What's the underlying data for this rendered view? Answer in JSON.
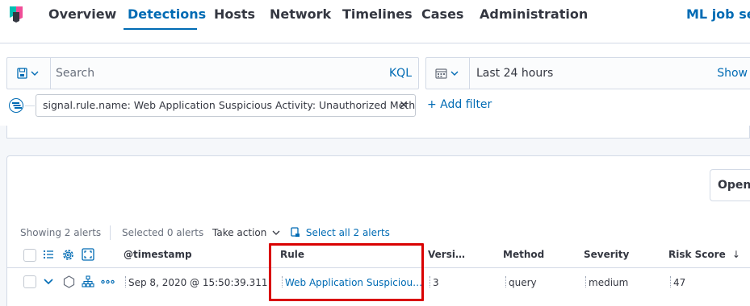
{
  "nav": {
    "tabs": [
      "Overview",
      "Detections",
      "Hosts",
      "Network",
      "Timelines",
      "Cases",
      "Administration"
    ],
    "active_tab": "Detections",
    "ml_link": "ML job set"
  },
  "query_bar": {
    "search_placeholder": "Search",
    "language": "KQL",
    "time_range": "Last 24 hours",
    "show_label": "Show"
  },
  "filters": {
    "pill_text": "signal.rule.name: Web Application Suspicious Activity: Unauthorized Method",
    "remove_glyph": "✕",
    "add_filter": "+ Add filter"
  },
  "panel": {
    "open_button": "Open"
  },
  "utility_bar": {
    "showing": "Showing 2 alerts",
    "selected": "Selected 0 alerts",
    "take_action": "Take action",
    "select_all": "Select all 2 alerts"
  },
  "table": {
    "columns": [
      "@timestamp",
      "Rule",
      "Versi…",
      "Method",
      "Severity",
      "Risk Score"
    ],
    "sort_glyph": "↓",
    "rows": [
      {
        "timestamp": "Sep 8, 2020 @ 15:50:39.311",
        "rule": "Web Application Suspiciou…",
        "version": "3",
        "method": "query",
        "severity": "medium",
        "risk_score": "47"
      }
    ]
  },
  "colors": {
    "accent": "#006bb4",
    "highlight": "#d90000"
  }
}
